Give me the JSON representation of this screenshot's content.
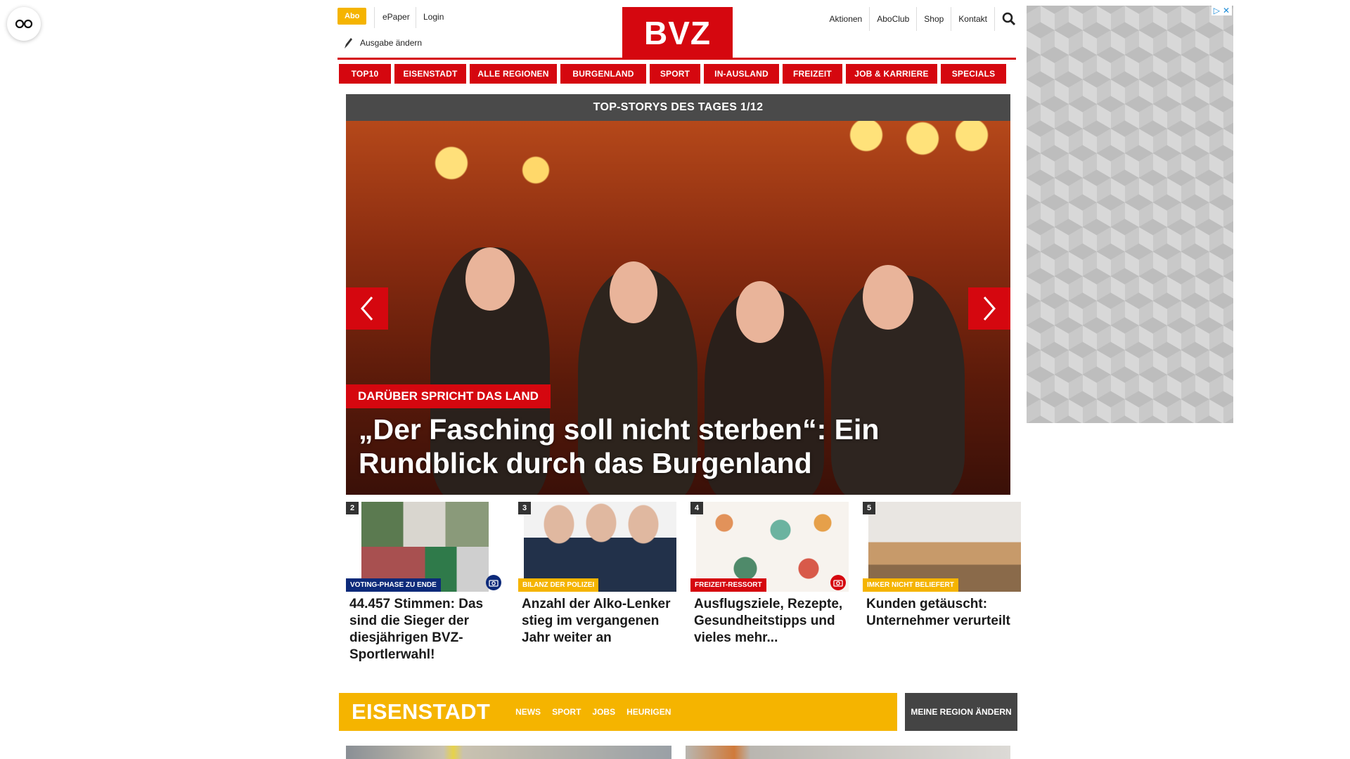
{
  "header": {
    "abo": "Abo",
    "epaper": "ePaper",
    "login": "Login",
    "ausgabe": "Ausgabe ändern",
    "logo": "BVZ",
    "links": [
      "Aktionen",
      "AboClub",
      "Shop",
      "Kontakt"
    ]
  },
  "nav": {
    "items": [
      "TOP10",
      "EISENSTADT",
      "ALLE REGIONEN",
      "BURGENLAND",
      "SPORT",
      "IN-AUSLAND",
      "FREIZEIT",
      "JOB & KARRIERE",
      "SPECIALS"
    ]
  },
  "slider": {
    "title": "TOP-STORYS DES TAGES 1/12",
    "kicker": "DARÜBER SPRICHT DAS LAND",
    "headline": "„Der Fasching soll nicht sterben“: Ein Rundblick durch das Burgenland"
  },
  "teasers": [
    {
      "num": "2",
      "badge": "VOTING-PHASE ZU ENDE",
      "badge_color": "#0d2a7a",
      "title": "44.457 Stimmen: Das sind die Sieger der diesjährigen BVZ-Sportlerwahl!",
      "camera": true
    },
    {
      "num": "3",
      "badge": "BILANZ DER POLIZEI",
      "badge_color": "#f5b400",
      "title": "Anzahl der Alko-Lenker stieg im vergangenen Jahr weiter an",
      "camera": false
    },
    {
      "num": "4",
      "badge": "FREIZEIT-RESSORT",
      "badge_color": "#d5070f",
      "title": "Ausflugsziele, Rezepte, Gesundheitstipps und vieles mehr...",
      "camera": true
    },
    {
      "num": "5",
      "badge": "IMKER NICHT BELIEFERT",
      "badge_color": "#f5b400",
      "title": "Kunden getäuscht: Unternehmer verurteilt",
      "camera": false
    }
  ],
  "region": {
    "name": "EISENSTADT",
    "links": [
      "NEWS",
      "SPORT",
      "JOBS",
      "HEURIGEN"
    ],
    "change": "MEINE REGION ÄNDERN"
  },
  "colors": {
    "brand_red": "#d5070f",
    "accent_yellow": "#f5b400",
    "dark_gray": "#4a4a4a"
  }
}
